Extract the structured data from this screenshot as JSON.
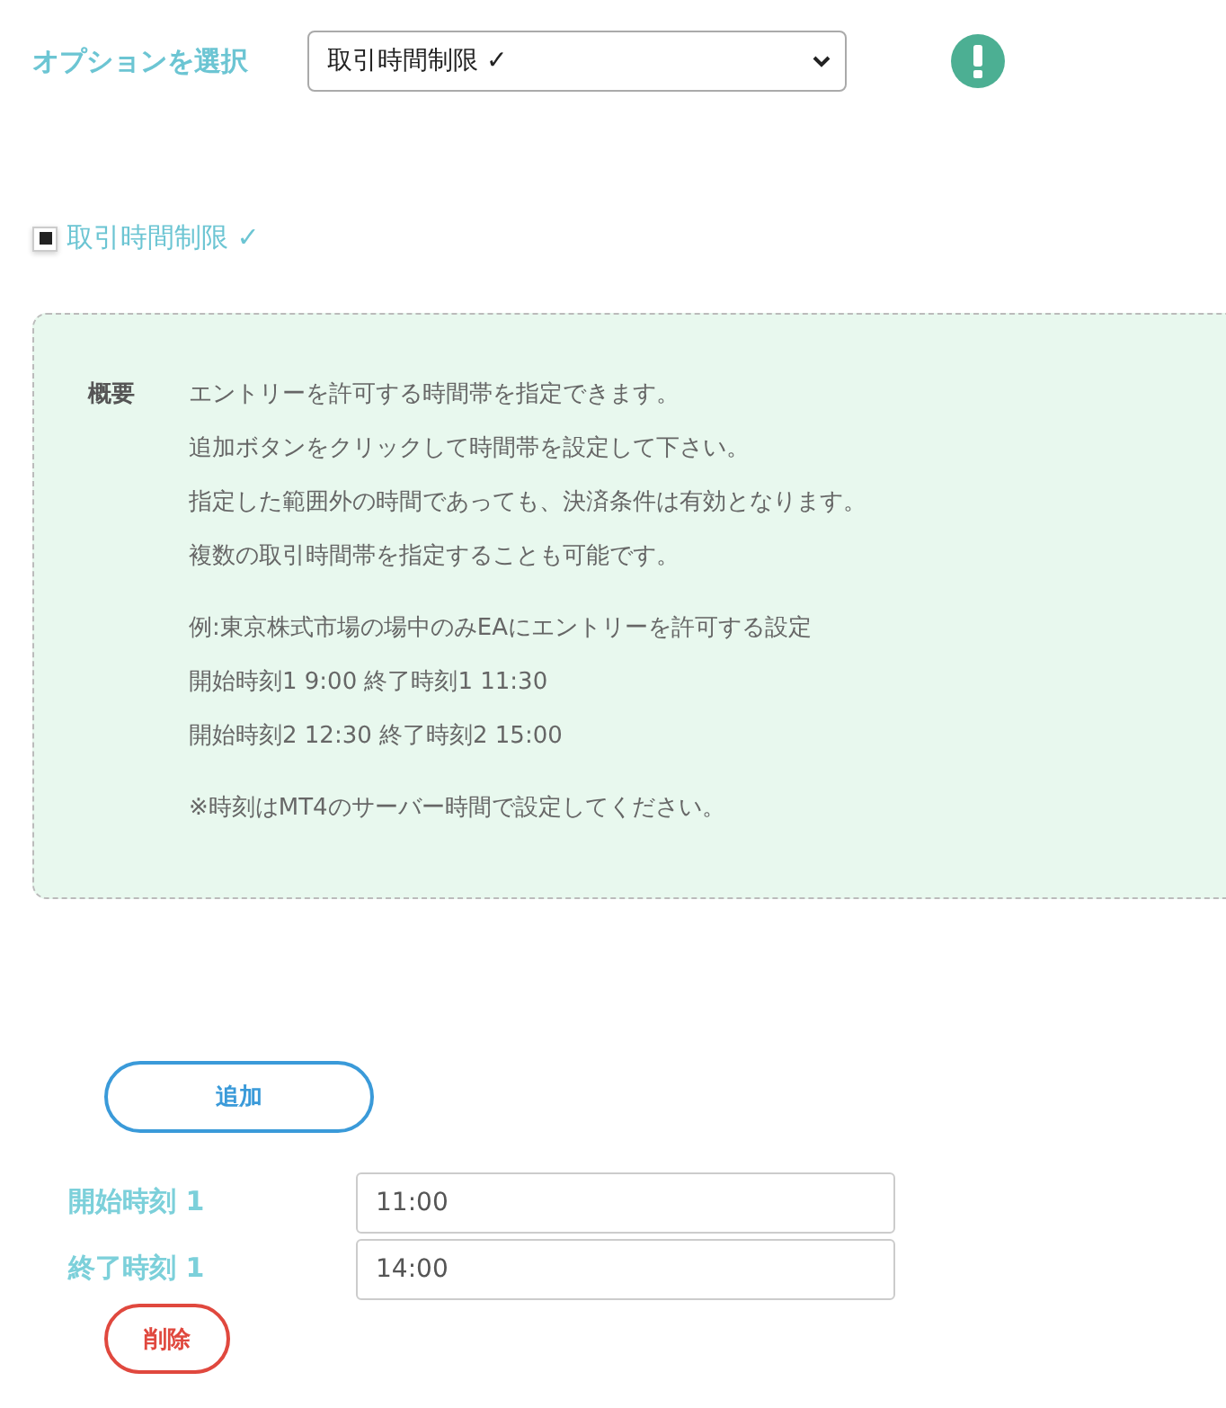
{
  "option_select": {
    "label": "オプションを選択",
    "value": "取引時間制限 ✓"
  },
  "option_checkbox": {
    "label": "取引時間制限 ✓",
    "checked": true
  },
  "overview": {
    "heading": "概要",
    "paragraphs": [
      [
        "エントリーを許可する時間帯を指定できます。",
        "追加ボタンをクリックして時間帯を設定して下さい。",
        "指定した範囲外の時間であっても、決済条件は有効となります。",
        "複数の取引時間帯を指定することも可能です。"
      ],
      [
        "例:東京株式市場の場中のみEAにエントリーを許可する設定",
        "開始時刻1 9:00 終了時刻1 11:30",
        "開始時刻2 12:30 終了時刻2 15:00"
      ],
      [
        "※時刻はMT4のサーバー時間で設定してください。"
      ]
    ]
  },
  "add_button": "追加",
  "time_ranges": [
    {
      "start_label": "開始時刻 1",
      "start_value": "11:00",
      "end_label": "終了時刻 1",
      "end_value": "14:00",
      "delete_button": "削除"
    }
  ]
}
